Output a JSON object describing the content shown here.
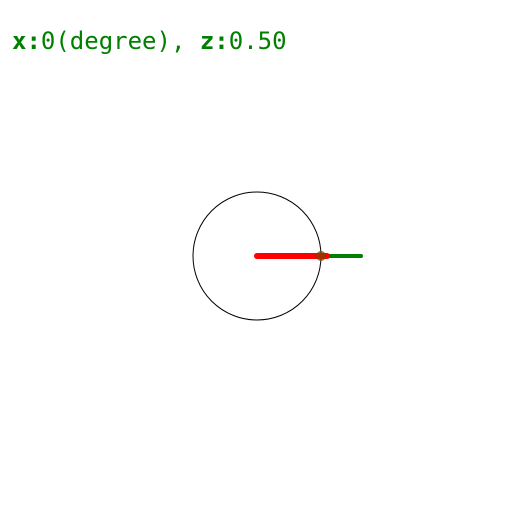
{
  "readout": {
    "x_label": "x:",
    "x_value": "0(degree)",
    "separator": ", ",
    "z_label": "z:",
    "z_value": "0.50"
  },
  "dial": {
    "angle_deg": 0,
    "z": 0.5,
    "colors": {
      "circle": "#000000",
      "red_arm": "#ff0000",
      "green_arm": "#008000",
      "text": "#008000",
      "background": "#ffffff"
    }
  }
}
